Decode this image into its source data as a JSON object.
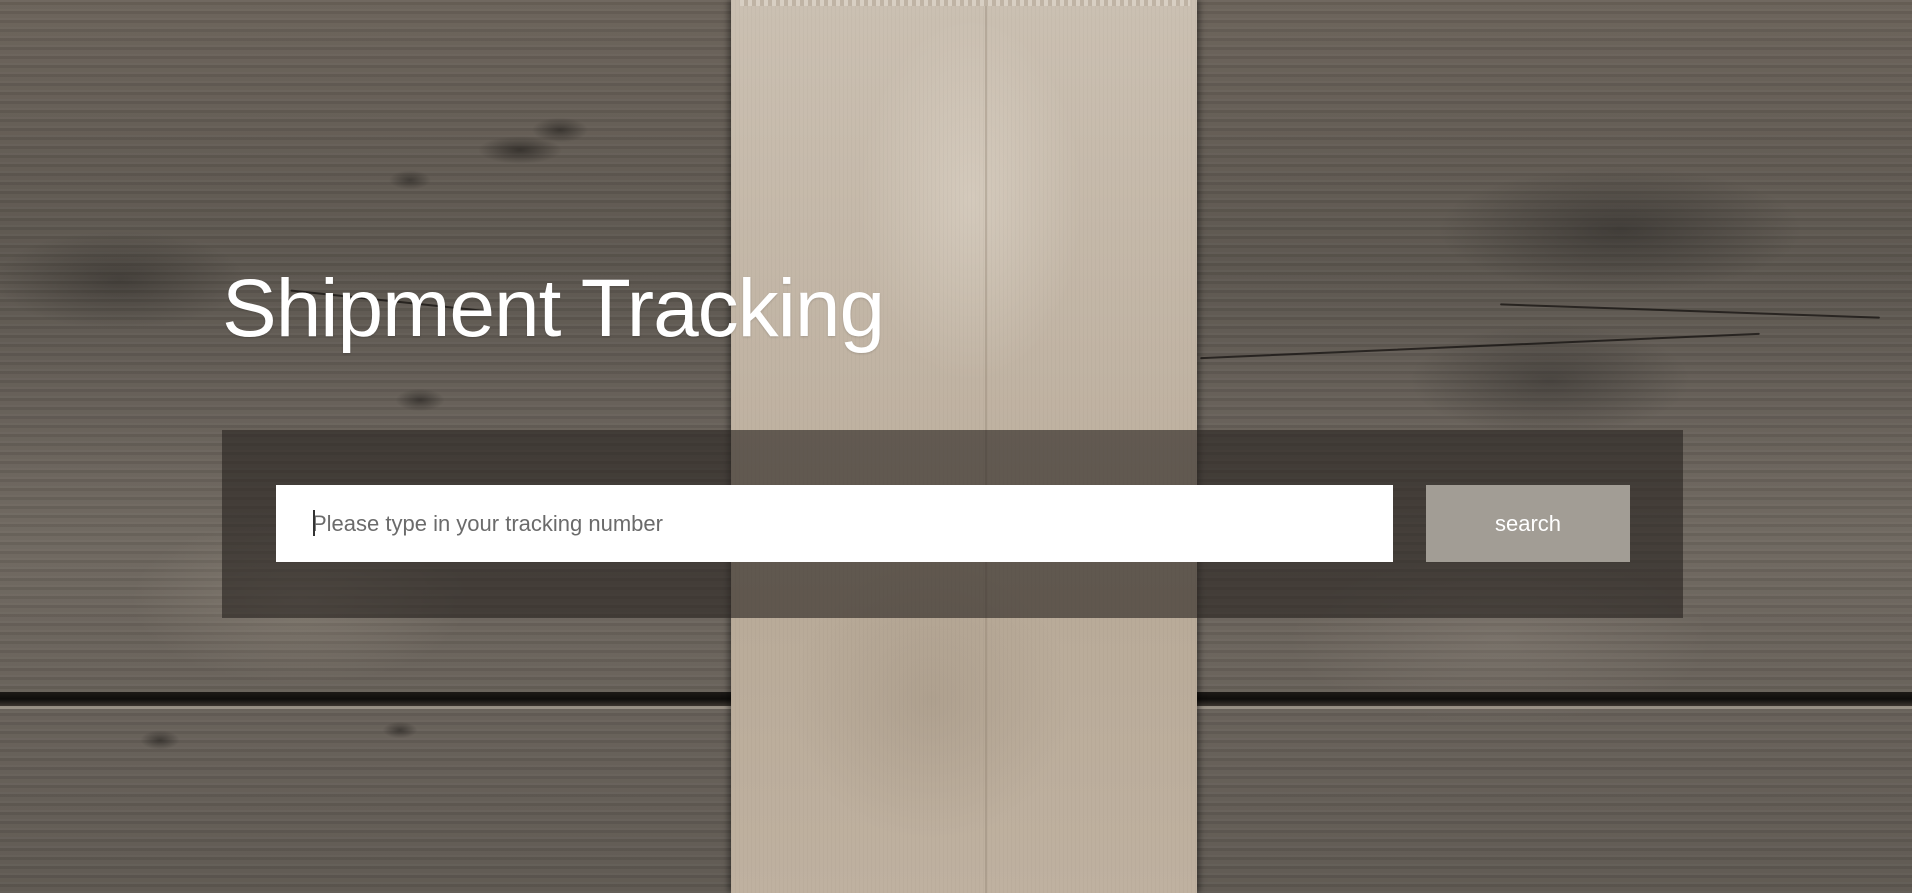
{
  "page": {
    "title": "Shipment Tracking"
  },
  "search": {
    "placeholder": "Please type in your tracking number",
    "value": "",
    "button_label": "search"
  },
  "colors": {
    "title": "#ffffff",
    "panel_overlay": "rgba(40,36,33,0.62)",
    "input_background": "#ffffff",
    "button_background": "#a29d95",
    "button_text": "#ffffff"
  }
}
